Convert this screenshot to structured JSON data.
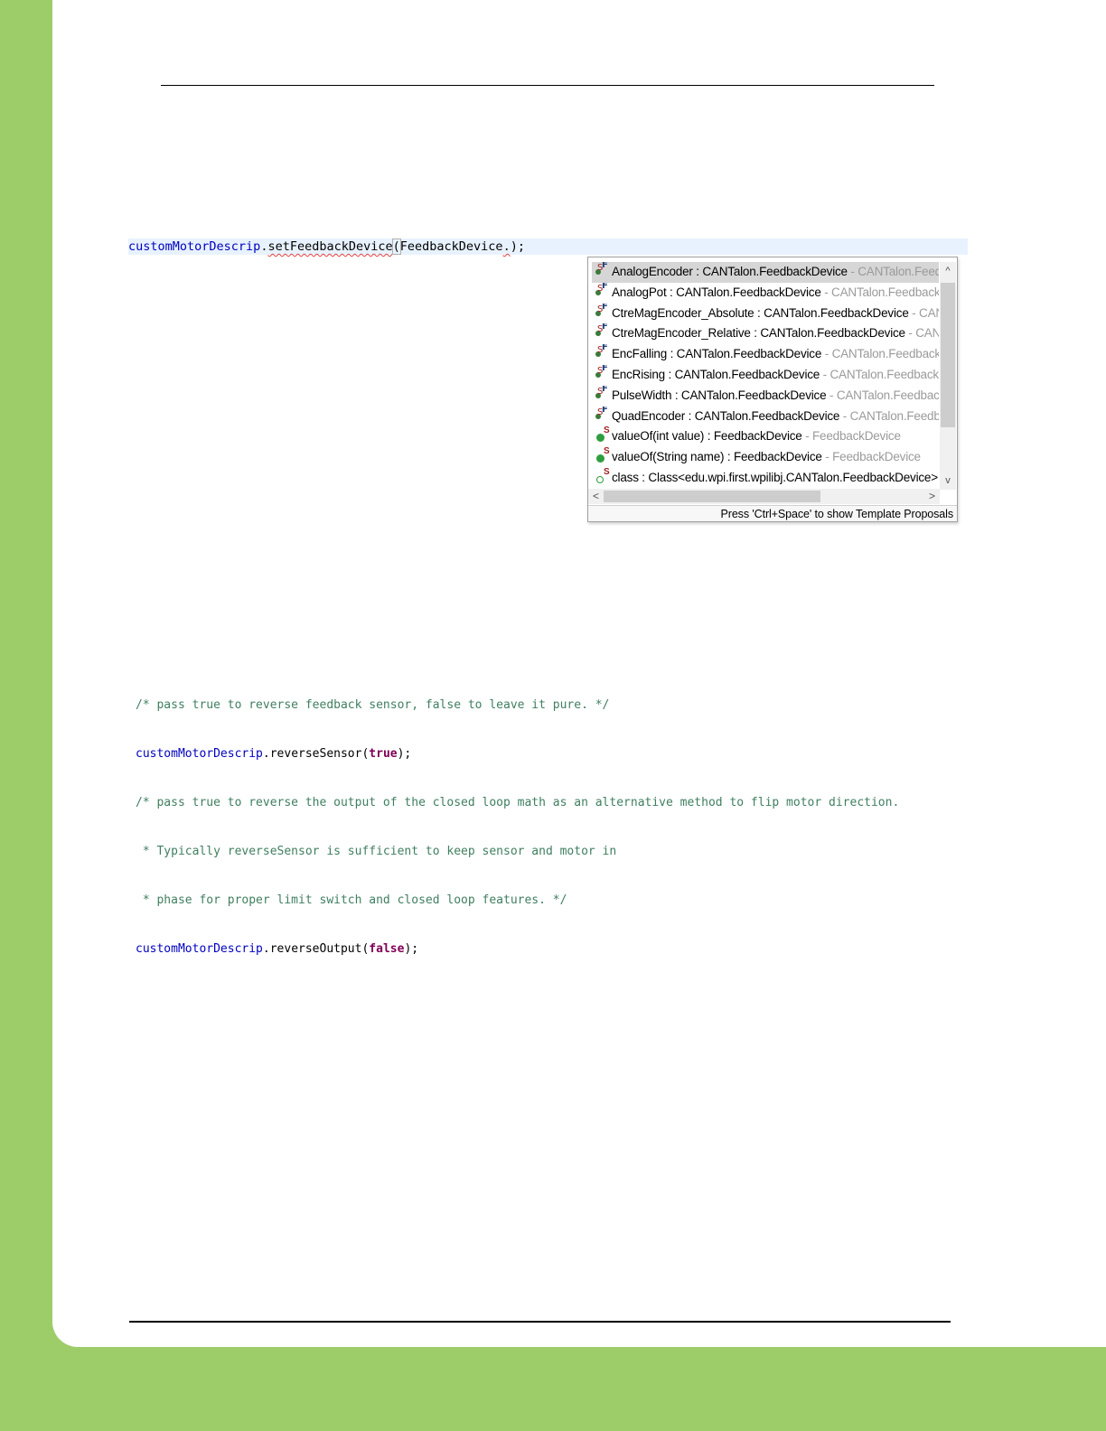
{
  "editor_line": {
    "field": "customMotorDescrip",
    "dot1": ".",
    "method": "setFeedbackDevice",
    "open_paren": "(",
    "arg": "FeedbackDevice",
    "dot2": ".",
    "close": ");"
  },
  "autocomplete": {
    "items": [
      {
        "icon": "static-final-field-icon",
        "name": "AnalogEncoder : CANTalon.FeedbackDevice",
        "qualifier": " - CANTalon.FeedbackDevice",
        "selected": true
      },
      {
        "icon": "static-final-field-icon",
        "name": "AnalogPot : CANTalon.FeedbackDevice",
        "qualifier": " - CANTalon.FeedbackDevice"
      },
      {
        "icon": "static-final-field-icon",
        "name": "CtreMagEncoder_Absolute : CANTalon.FeedbackDevice",
        "qualifier": " - CANTalon.FeedbackDevice"
      },
      {
        "icon": "static-final-field-icon",
        "name": "CtreMagEncoder_Relative : CANTalon.FeedbackDevice",
        "qualifier": " - CANTalon.FeedbackDevice"
      },
      {
        "icon": "static-final-field-icon",
        "name": "EncFalling : CANTalon.FeedbackDevice",
        "qualifier": " - CANTalon.FeedbackDevice"
      },
      {
        "icon": "static-final-field-icon",
        "name": "EncRising : CANTalon.FeedbackDevice",
        "qualifier": " - CANTalon.FeedbackDevice"
      },
      {
        "icon": "static-final-field-icon",
        "name": "PulseWidth : CANTalon.FeedbackDevice",
        "qualifier": " - CANTalon.FeedbackDevice"
      },
      {
        "icon": "static-final-field-icon",
        "name": "QuadEncoder : CANTalon.FeedbackDevice",
        "qualifier": " - CANTalon.FeedbackDevice"
      },
      {
        "icon": "static-method-icon",
        "name": "valueOf(int value) : FeedbackDevice",
        "qualifier": " - FeedbackDevice"
      },
      {
        "icon": "static-method-icon",
        "name": "valueOf(String name) : FeedbackDevice",
        "qualifier": " - FeedbackDevice"
      },
      {
        "icon": "static-class-icon",
        "name": "class : Class<edu.wpi.first.wpilibj.CANTalon.FeedbackDevice>",
        "qualifier": ""
      }
    ],
    "footer": "Press 'Ctrl+Space' to show Template Proposals",
    "scroll_up_glyph": "^",
    "scroll_down_glyph": "v",
    "scroll_left_glyph": "<",
    "scroll_right_glyph": ">"
  },
  "code": {
    "line1": "/* pass true to reverse feedback sensor, false to leave it pure. */",
    "line2_field": "customMotorDescrip",
    "line2_call": ".reverseSensor(",
    "line2_kw": "true",
    "line2_end": ");",
    "line3": "/* pass true to reverse the output of the closed loop math as an alternative method to flip motor direction.",
    "line4": " * Typically reverseSensor is sufficient to keep sensor and motor in",
    "line5": " * phase for proper limit switch and closed loop features. */",
    "line6_field": "customMotorDescrip",
    "line6_call": ".reverseOutput(",
    "line6_kw": "false",
    "line6_end": ");"
  },
  "colors": {
    "page_margin": "#9dcd69",
    "code_comment": "#3f7f5f",
    "code_field": "#0000c0",
    "code_keyword": "#7f0055",
    "editor_highlight": "#e8f2fe"
  }
}
